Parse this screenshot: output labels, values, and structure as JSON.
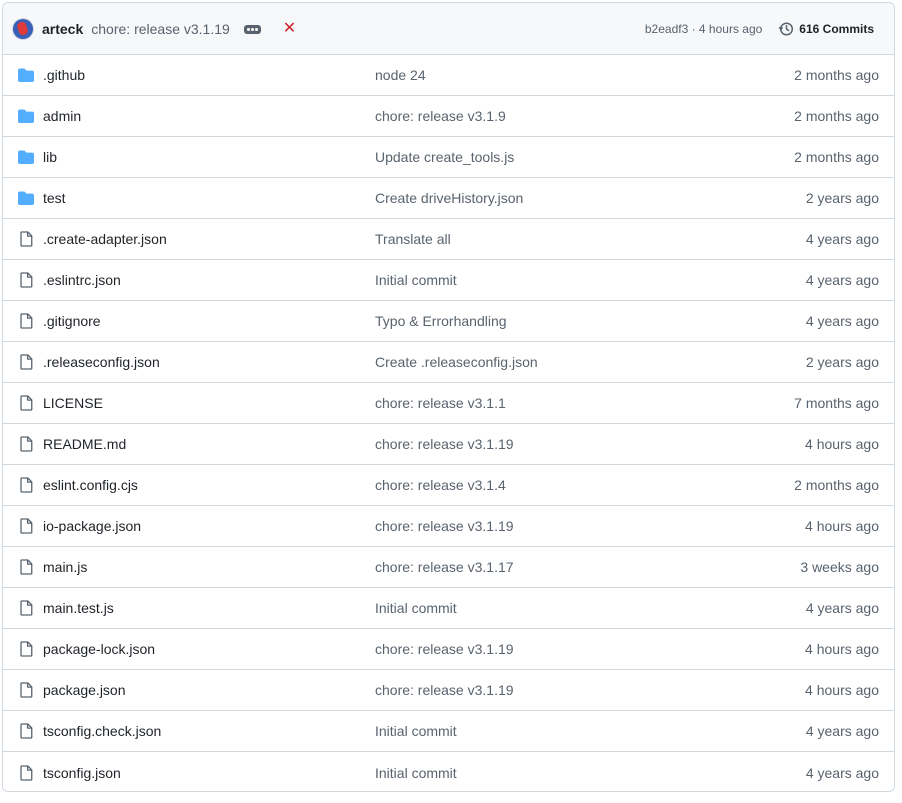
{
  "header": {
    "author": "arteck",
    "message": "chore: release v3.1.19",
    "status": "✕",
    "sha_time": "b2eadf3 · 4 hours ago",
    "commits_label": "616 Commits",
    "status_color": "#cf222e",
    "folder_color": "#54aeff"
  },
  "files": [
    {
      "type": "folder",
      "name": ".github",
      "message": "node 24",
      "age": "2 months ago"
    },
    {
      "type": "folder",
      "name": "admin",
      "message": "chore: release v3.1.9",
      "age": "2 months ago"
    },
    {
      "type": "folder",
      "name": "lib",
      "message": "Update create_tools.js",
      "age": "2 months ago"
    },
    {
      "type": "folder",
      "name": "test",
      "message": "Create driveHistory.json",
      "age": "2 years ago"
    },
    {
      "type": "file",
      "name": ".create-adapter.json",
      "message": "Translate all",
      "age": "4 years ago"
    },
    {
      "type": "file",
      "name": ".eslintrc.json",
      "message": "Initial commit",
      "age": "4 years ago"
    },
    {
      "type": "file",
      "name": ".gitignore",
      "message": "Typo & Errorhandling",
      "age": "4 years ago"
    },
    {
      "type": "file",
      "name": ".releaseconfig.json",
      "message": "Create .releaseconfig.json",
      "age": "2 years ago"
    },
    {
      "type": "file",
      "name": "LICENSE",
      "message": "chore: release v3.1.1",
      "age": "7 months ago"
    },
    {
      "type": "file",
      "name": "README.md",
      "message": "chore: release v3.1.19",
      "age": "4 hours ago"
    },
    {
      "type": "file",
      "name": "eslint.config.cjs",
      "message": "chore: release v3.1.4",
      "age": "2 months ago"
    },
    {
      "type": "file",
      "name": "io-package.json",
      "message": "chore: release v3.1.19",
      "age": "4 hours ago"
    },
    {
      "type": "file",
      "name": "main.js",
      "message": "chore: release v3.1.17",
      "age": "3 weeks ago"
    },
    {
      "type": "file",
      "name": "main.test.js",
      "message": "Initial commit",
      "age": "4 years ago"
    },
    {
      "type": "file",
      "name": "package-lock.json",
      "message": "chore: release v3.1.19",
      "age": "4 hours ago"
    },
    {
      "type": "file",
      "name": "package.json",
      "message": "chore: release v3.1.19",
      "age": "4 hours ago"
    },
    {
      "type": "file",
      "name": "tsconfig.check.json",
      "message": "Initial commit",
      "age": "4 years ago"
    },
    {
      "type": "file",
      "name": "tsconfig.json",
      "message": "Initial commit",
      "age": "4 years ago"
    }
  ]
}
